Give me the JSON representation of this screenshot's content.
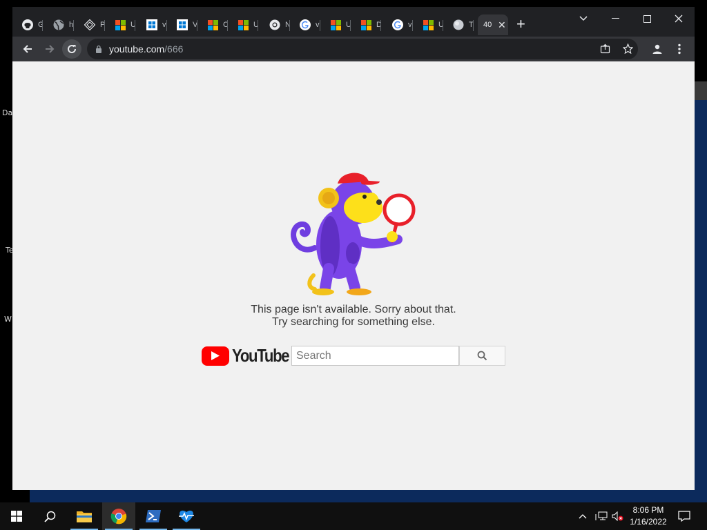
{
  "desktop": {
    "side_labels": [
      "Da",
      "Te",
      "W"
    ]
  },
  "browser": {
    "tabs": [
      {
        "title": "G",
        "icon": "github-icon"
      },
      {
        "title": "h",
        "icon": "globe-icon"
      },
      {
        "title": "P",
        "icon": "hex-logo-icon"
      },
      {
        "title": "U",
        "icon": "microsoft-icon"
      },
      {
        "title": "v",
        "icon": "windows-icon"
      },
      {
        "title": "V",
        "icon": "windows-icon"
      },
      {
        "title": "C",
        "icon": "microsoft-icon"
      },
      {
        "title": "U",
        "icon": "microsoft-icon"
      },
      {
        "title": "N",
        "icon": "chrome-icon"
      },
      {
        "title": "v",
        "icon": "google-icon"
      },
      {
        "title": "U",
        "icon": "microsoft-icon"
      },
      {
        "title": "D",
        "icon": "microsoft-icon"
      },
      {
        "title": "v",
        "icon": "google-icon"
      },
      {
        "title": "U",
        "icon": "microsoft-icon"
      },
      {
        "title": "T",
        "icon": "globe-gray-icon"
      }
    ],
    "active_tab": {
      "title": "40",
      "icon": "none"
    },
    "address": {
      "host": "youtube.com",
      "path": "/666"
    }
  },
  "page": {
    "message_line1": "This page isn't available. Sorry about that.",
    "message_line2": "Try searching for something else.",
    "logo_text": "YouTube",
    "search_placeholder": "Search"
  },
  "taskbar": {
    "time": "8:06 PM",
    "date": "1/16/2022"
  },
  "colors": {
    "youtube_red": "#ff0000",
    "chrome_dark": "#202124",
    "taskbar": "#101010"
  }
}
